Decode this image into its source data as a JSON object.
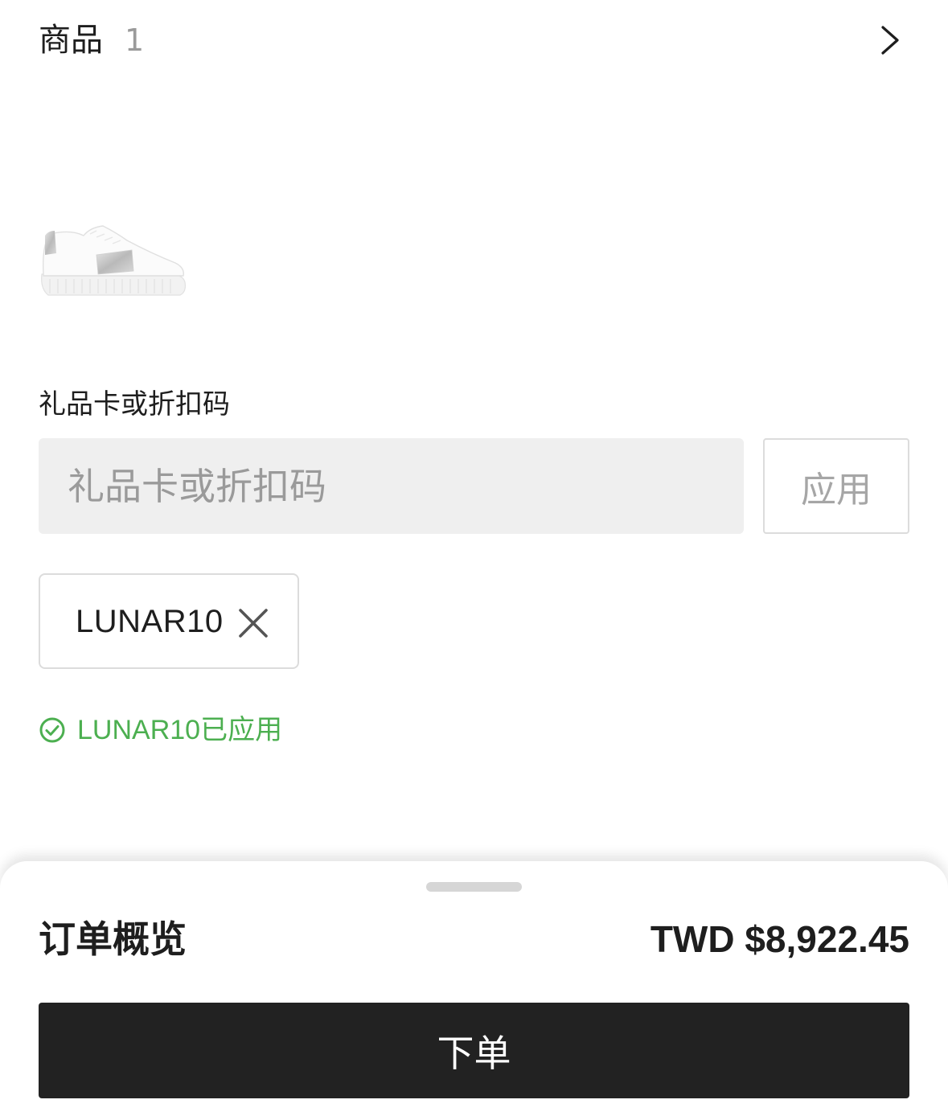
{
  "items_header": {
    "title": "商品",
    "count": "1",
    "chevron_icon": "chevron-right-icon"
  },
  "product": {
    "image_icon": "white-sneaker-image"
  },
  "promo": {
    "label": "礼品卡或折扣码",
    "placeholder": "礼品卡或折扣码",
    "value": "",
    "apply_label": "应用",
    "applied_code": "LUNAR10",
    "remove_icon": "close-icon",
    "status_text": "LUNAR10已应用",
    "status_icon": "check-circle-icon",
    "status_color": "#4caf50"
  },
  "summary": {
    "title": "订单概览",
    "total": "TWD $8,922.45",
    "place_order_label": "下单",
    "button_color": "#222222"
  }
}
